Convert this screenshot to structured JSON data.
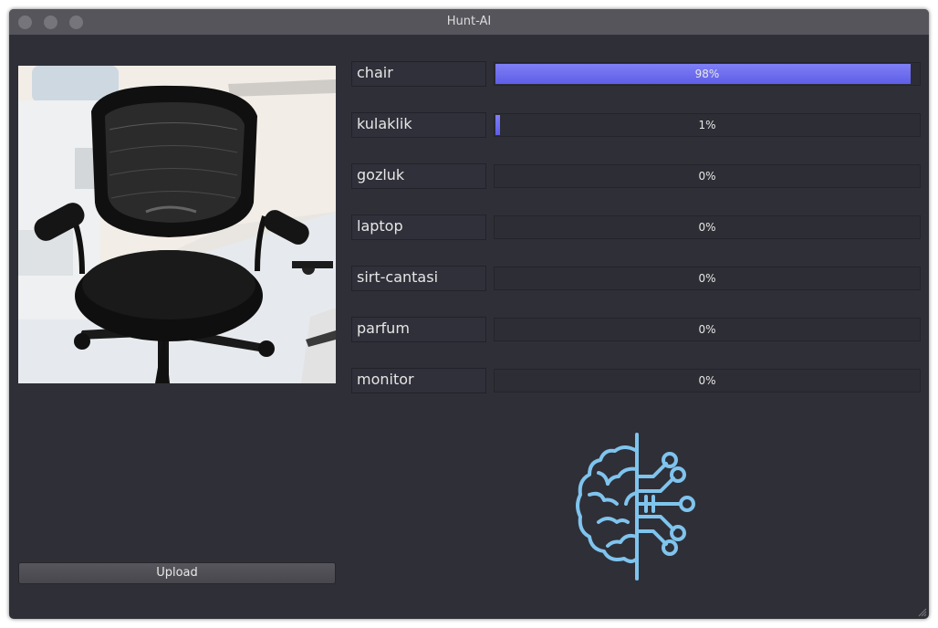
{
  "window": {
    "title": "Hunt-AI"
  },
  "predictions": [
    {
      "label": "chair",
      "percent": 98,
      "percent_text": "98%"
    },
    {
      "label": "kulaklik",
      "percent": 1,
      "percent_text": "1%"
    },
    {
      "label": "gozluk",
      "percent": 0,
      "percent_text": "0%"
    },
    {
      "label": "laptop",
      "percent": 0,
      "percent_text": "0%"
    },
    {
      "label": "sirt-cantasi",
      "percent": 0,
      "percent_text": "0%"
    },
    {
      "label": "parfum",
      "percent": 0,
      "percent_text": "0%"
    },
    {
      "label": "monitor",
      "percent": 0,
      "percent_text": "0%"
    }
  ],
  "upload_button": {
    "label": "Upload"
  },
  "icons": {
    "logo": "ai-brain-circuit-icon",
    "window_controls": [
      "close-icon",
      "minimize-icon",
      "maximize-icon"
    ]
  },
  "colors": {
    "progress_fill": "#6a6af0",
    "logo": "#7fc4ee",
    "background": "#2f2f37"
  }
}
